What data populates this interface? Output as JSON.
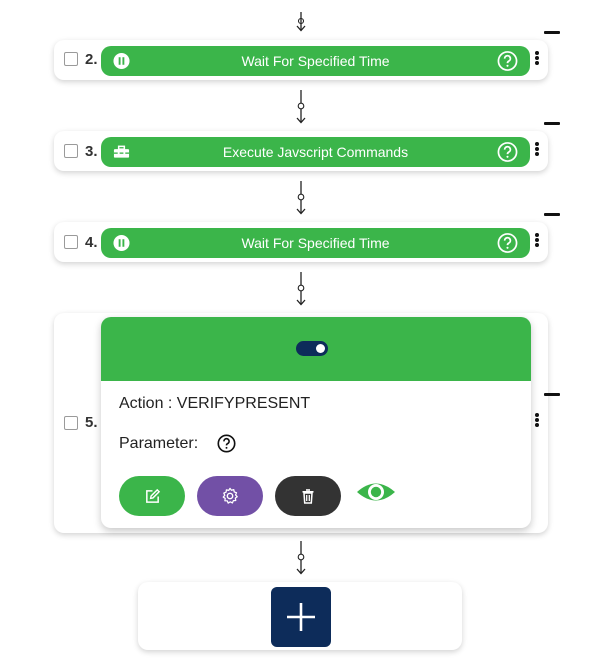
{
  "colors": {
    "accent_green": "#3bb54a",
    "navy": "#0d2c5a",
    "purple": "#7250a6",
    "dark_gray": "#333333"
  },
  "steps": [
    {
      "number": "2.",
      "label": "Wait For Specified Time",
      "icon": "pause-icon"
    },
    {
      "number": "3.",
      "label": "Execute Javscript Commands",
      "icon": "toolbox-icon"
    },
    {
      "number": "4.",
      "label": "Wait For Specified Time",
      "icon": "pause-icon"
    }
  ],
  "expanded_step": {
    "number": "5.",
    "toggle_state": "on",
    "action_text": "Action : VERIFYPRESENT",
    "parameter_text": "Parameter:",
    "buttons": [
      "edit-icon",
      "gear-icon",
      "trash-icon",
      "eye-icon"
    ]
  },
  "add_button": {
    "icon": "plus-icon"
  }
}
